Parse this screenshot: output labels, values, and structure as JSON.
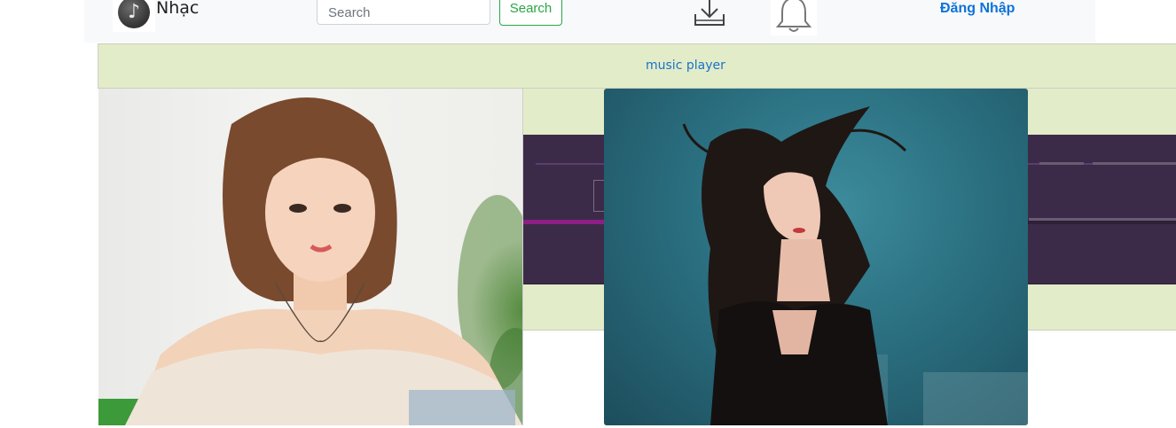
{
  "navbar": {
    "logo_icon": "music-note-icon",
    "logo_glyph": "♪",
    "brand": "Nhạc",
    "search_placeholder": "Search",
    "search_button": "Search",
    "download_icon": "download-icon",
    "bell_icon": "bell-icon",
    "login": "Đăng Nhập"
  },
  "banner": {
    "text": "music player"
  },
  "gallery": {
    "photos": [
      {
        "alt": "Smiling woman in off-shoulder top"
      },
      {
        "alt": "Woman with windblown hair against teal background"
      }
    ]
  },
  "colors": {
    "banner_bg": "#e2ecc9",
    "player_bg": "#3c2b48",
    "progress": "#8e1f86",
    "link": "#0d72d8",
    "search_button": "#28a745"
  }
}
